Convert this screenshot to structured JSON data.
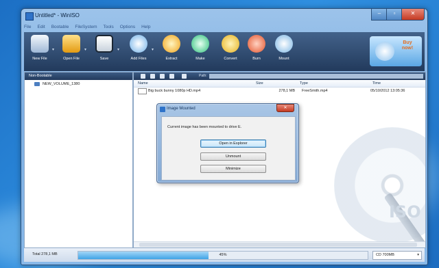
{
  "window": {
    "title": "Untitled* - WinISO",
    "min": "‒",
    "max": "▫",
    "close": "✕"
  },
  "menu": [
    "File",
    "Edit",
    "Bootable",
    "FileSystem",
    "Tools",
    "Options",
    "Help"
  ],
  "toolbar": {
    "buttons": [
      {
        "label": "New File",
        "icon": "new-file-icon"
      },
      {
        "label": "Open File",
        "icon": "open-folder-icon"
      },
      {
        "label": "Save",
        "icon": "save-icon"
      },
      {
        "label": "Add Files",
        "icon": "add-files-icon"
      },
      {
        "label": "Extract",
        "icon": "extract-icon"
      },
      {
        "label": "Make",
        "icon": "make-icon"
      },
      {
        "label": "Convert",
        "icon": "convert-icon"
      },
      {
        "label": "Burn",
        "icon": "burn-icon"
      },
      {
        "label": "Mount",
        "icon": "mount-icon"
      }
    ],
    "buy": "Buy now!"
  },
  "left_pane": {
    "header": "Non-Bootable",
    "volume": "NEW_VOLUME_1380"
  },
  "right_pane": {
    "path_label": "Path:",
    "columns": [
      "Name",
      "Size",
      "Type",
      "Time"
    ],
    "files": [
      {
        "name": "Big buck bunny 1080p HD.mp4",
        "size": "278,1 MB",
        "type": "FreeSmith.mp4",
        "time": "05/10/2012 13:05:36"
      }
    ]
  },
  "status": {
    "total": "Total 278,1 MB",
    "progress_text": "45%",
    "progress": 0.45,
    "disc": "CD 700MB"
  },
  "dialog": {
    "title": "Image Mounted",
    "close": "✕",
    "message": "Current image has been mounted to drive E.",
    "buttons": [
      "Open in Explorer",
      "Unmount",
      "Minimize"
    ]
  },
  "watermark": {
    "text": "ISO"
  }
}
